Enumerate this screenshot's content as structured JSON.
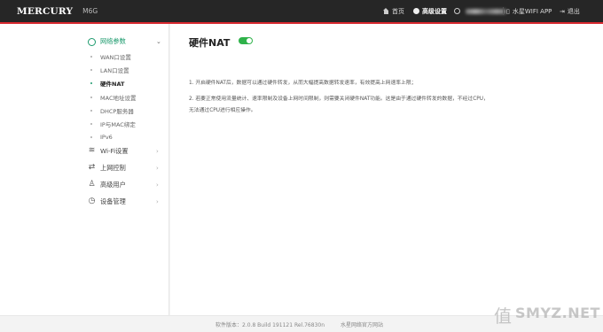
{
  "header": {
    "brand": "MERCURY",
    "model": "M6G",
    "nav_home": "首页",
    "nav_advanced": "高级设置",
    "nav_user": "",
    "nav_app": "水星WIFI APP",
    "nav_exit": "退出"
  },
  "sidebar": {
    "groups": [
      {
        "label": "网络参数",
        "icon": "globe-icon",
        "expanded": true
      },
      {
        "label": "Wi-Fi设置",
        "icon": "wifi-icon"
      },
      {
        "label": "上网控制",
        "icon": "arrows-icon"
      },
      {
        "label": "高级用户",
        "icon": "user-icon"
      },
      {
        "label": "设备管理",
        "icon": "clock-icon"
      }
    ],
    "sub_items": [
      {
        "label": "WAN口设置"
      },
      {
        "label": "LAN口设置"
      },
      {
        "label": "硬件NAT",
        "active": true
      },
      {
        "label": "MAC地址设置"
      },
      {
        "label": "DHCP服务器"
      },
      {
        "label": "IP与MAC绑定"
      },
      {
        "label": "IPv6"
      }
    ]
  },
  "content": {
    "title": "硬件NAT",
    "toggle_on": true,
    "notes": [
      "1. 开启硬件NAT后，数据可以通过硬件转发，从而大幅提高数据转发速率，有效提高上网速率上限；",
      "2. 若要正常使用流量统计、速率限制及设备上网时间限制，则需要关闭硬件NAT功能。这是由于通过硬件转发的数据，不经过CPU，",
      "无法通过CPU进行相应操作。"
    ]
  },
  "footer": {
    "version": "软件版本：2.0.8 Build 191121 Rel.76830n",
    "site": "水星网络官方网站"
  },
  "watermark": {
    "text": "SMYZ.NET",
    "glyph": "值"
  },
  "colors": {
    "topbar": "#262626",
    "accent_red": "#d7282f",
    "accent_green": "#1c9a6d",
    "toggle_green": "#2fb24a"
  }
}
